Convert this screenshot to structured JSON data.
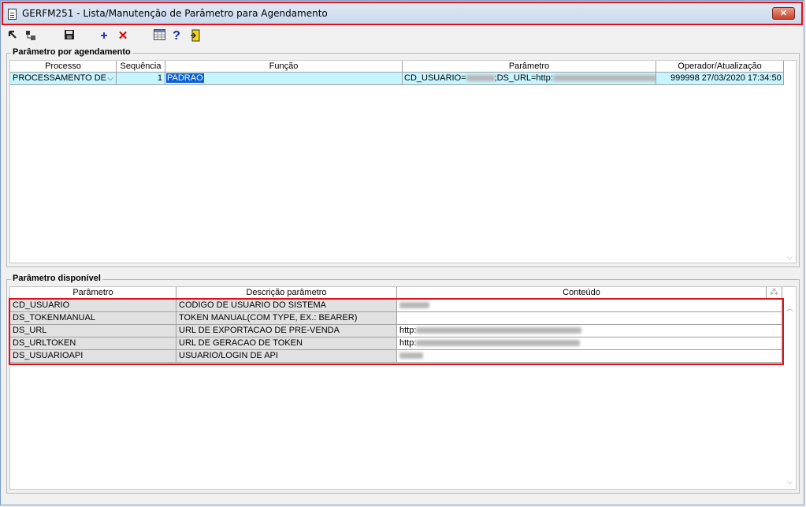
{
  "window": {
    "title": "GERFM251 - Lista/Manutenção de Parâmetro para Agendamento",
    "close_label": "✕"
  },
  "toolbar": {
    "icons": [
      "back-arrow-icon",
      "tree-icon",
      "save-icon",
      "add-icon",
      "delete-icon",
      "calculator-icon",
      "help-icon",
      "exit-icon"
    ],
    "add_glyph": "+",
    "delete_glyph": "✕",
    "help_glyph": "?"
  },
  "agendamento": {
    "legend": "Parâmetro por agendamento",
    "columns": [
      "Processo",
      "Sequência",
      "Função",
      "Parâmetro",
      "Operador/Atualização"
    ],
    "row": {
      "processo": "PROCESSAMENTO DE",
      "sequencia": "1",
      "funcao": "PADRAO",
      "parametro_prefix": "CD_USUARIO=",
      "parametro_mid": ";DS_URL=http:",
      "parametro_suffix": "tior",
      "operador": "999998",
      "atualizacao": "27/03/2020 17:34:50"
    }
  },
  "disponivel": {
    "legend": "Parâmetro disponível",
    "columns": [
      "Parâmetro",
      "Descrição parâmetro",
      "Conteúdo"
    ],
    "rows": [
      {
        "parametro": "CD_USUARIO",
        "descricao": "CODIGO DE USUARIO DO SISTEMA",
        "conteudo": ""
      },
      {
        "parametro": "DS_TOKENMANUAL",
        "descricao": "TOKEN MANUAL(COM TYPE, EX.: BEARER)",
        "conteudo": ""
      },
      {
        "parametro": "DS_URL",
        "descricao": "URL DE EXPORTACAO DE PRE-VENDA",
        "conteudo": "http:"
      },
      {
        "parametro": "DS_URLTOKEN",
        "descricao": "URL DE GERACAO DE TOKEN",
        "conteudo": "http:"
      },
      {
        "parametro": "DS_USUARIOAPI",
        "descricao": "USUARIO/LOGIN DE API",
        "conteudo": ""
      }
    ]
  },
  "colors": {
    "highlight_border": "#e0101b",
    "selection": "#c6f4ff",
    "focus": "#0a5fd6"
  }
}
